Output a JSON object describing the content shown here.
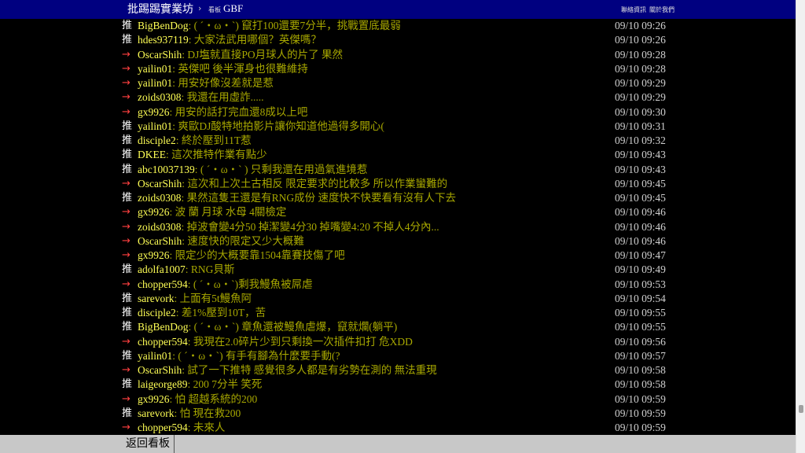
{
  "header": {
    "brand": "批踢踢實業坊",
    "separator": "›",
    "board_label": "看板",
    "board_name": "GBF",
    "links": [
      "聯絡資訊",
      "關於我們"
    ]
  },
  "pushes": [
    {
      "tag": "推",
      "user": "BigBenDog",
      "content": "( ´・ω・`) 竄打100還要7分半，挑戰置底最弱",
      "time": "09/10 09:26"
    },
    {
      "tag": "推",
      "user": "hdes937119",
      "content": "大家法武用哪個？英傑嗎？",
      "time": "09/10 09:26"
    },
    {
      "tag": "→",
      "user": "OscarShih",
      "content": "DJ塩就直接PO月球人的片了 果然",
      "time": "09/10 09:28"
    },
    {
      "tag": "→",
      "user": "yailin01",
      "content": "英傑吧 後半渾身也很難維持",
      "time": "09/10 09:28"
    },
    {
      "tag": "→",
      "user": "yailin01",
      "content": "用安好像沒差就是惹",
      "time": "09/10 09:29"
    },
    {
      "tag": "→",
      "user": "zoids0308",
      "content": "我還在用虛詐.....",
      "time": "09/10 09:29"
    },
    {
      "tag": "→",
      "user": "gx9926",
      "content": "用安的話打完血還8成以上吧",
      "time": "09/10 09:30"
    },
    {
      "tag": "推",
      "user": "yailin01",
      "content": "爽歐DJ酸特地拍影片讓你知道他過得多開心(",
      "time": "09/10 09:31"
    },
    {
      "tag": "推",
      "user": "disciple2",
      "content": "終於壓到11T惹",
      "time": "09/10 09:32"
    },
    {
      "tag": "推",
      "user": "DKEE",
      "content": "這次推特作業有點少",
      "time": "09/10 09:43"
    },
    {
      "tag": "推",
      "user": "abc10037139",
      "content": "( ´・ω・` ) 只剩我還在用過氣進境惹",
      "time": "09/10 09:43"
    },
    {
      "tag": "→",
      "user": "OscarShih",
      "content": "這次和上次土古相反 限定要求的比較多 所以作業蠻難的",
      "time": "09/10 09:45"
    },
    {
      "tag": "推",
      "user": "zoids0308",
      "content": "果然這隻王還是有RNG成份 速度快不快要看有沒有人下去",
      "time": "09/10 09:45"
    },
    {
      "tag": "→",
      "user": "gx9926",
      "content": "波 蘭 月球 水母 4關檢定",
      "time": "09/10 09:46"
    },
    {
      "tag": "→",
      "user": "zoids0308",
      "content": "掉波會變4分50 掉潔變4分30 掉嘴變4:20 不掉人4分內...",
      "time": "09/10 09:46"
    },
    {
      "tag": "→",
      "user": "OscarShih",
      "content": "速度快的限定又少大概難",
      "time": "09/10 09:46"
    },
    {
      "tag": "→",
      "user": "gx9926",
      "content": "限定少的大概要靠1504靠賽技傷了吧",
      "time": "09/10 09:47"
    },
    {
      "tag": "推",
      "user": "adolfa1007",
      "content": "RNG貝斯",
      "time": "09/10 09:49"
    },
    {
      "tag": "→",
      "user": "chopper594",
      "content": "( ´・ω・`)剩我鰻魚被屌虐",
      "time": "09/10 09:53"
    },
    {
      "tag": "推",
      "user": "sarevork",
      "content": "上面有5t鰻魚阿",
      "time": "09/10 09:54"
    },
    {
      "tag": "推",
      "user": "disciple2",
      "content": "差1%壓到10T，苦",
      "time": "09/10 09:55"
    },
    {
      "tag": "推",
      "user": "BigBenDog",
      "content": "( ´・ω・`) 章魚還被鰻魚虐爆，竄就爛(躺平)",
      "time": "09/10 09:55"
    },
    {
      "tag": "→",
      "user": "chopper594",
      "content": "我現在2.0碎片少到只剩換一次插件扣打 危XDD",
      "time": "09/10 09:56"
    },
    {
      "tag": "推",
      "user": "yailin01",
      "content": "( ´・ω・`) 有手有腳為什麼要手動(?",
      "time": "09/10 09:57"
    },
    {
      "tag": "→",
      "user": "OscarShih",
      "content": "試了一下推特 感覺很多人都是有劣勢在測的 無法重現",
      "time": "09/10 09:58"
    },
    {
      "tag": "推",
      "user": "laigeorge89",
      "content": "200 7分半 笑死",
      "time": "09/10 09:58"
    },
    {
      "tag": "→",
      "user": "gx9926",
      "content": "怕 超越系統的200",
      "time": "09/10 09:59"
    },
    {
      "tag": "推",
      "user": "sarevork",
      "content": "怕 現在救200",
      "time": "09/10 09:59"
    },
    {
      "tag": "→",
      "user": "chopper594",
      "content": "未來人",
      "time": "09/10 09:59"
    }
  ],
  "footer": {
    "back_label": "返回看板"
  },
  "colors": {
    "header_bg": "#000080",
    "page_bg": "#000000",
    "user": "#ffff55",
    "content": "#a8a800",
    "push_up": "#ffffff",
    "push_arrow": "#ff4040",
    "footer_bg": "#c8c8c8"
  }
}
